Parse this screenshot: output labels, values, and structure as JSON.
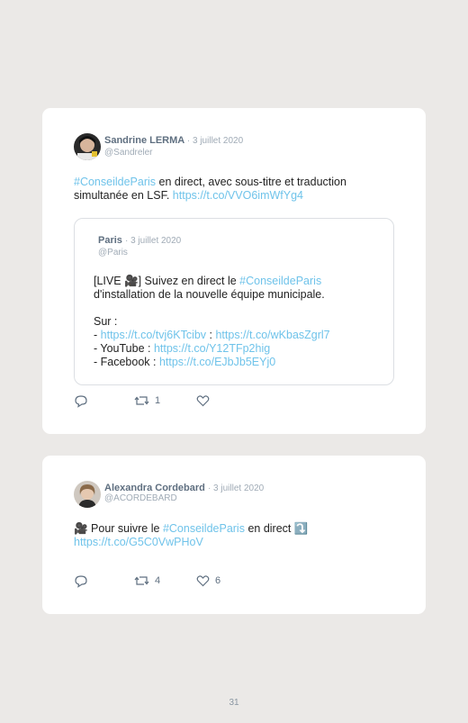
{
  "tweet1": {
    "author": "Sandrine LERMA",
    "date": "· 3 juillet 2020",
    "handle": "@Sandreler",
    "line1_tag": "#ConseildeParis",
    "line1_rest": " en direct, avec sous-titre et traduction",
    "line2_text": "simultanée en LSF. ",
    "line2_link": "https://t.co/VVO6imWfYg4",
    "quoted": {
      "author": "Paris",
      "date": "· 3 juillet 2020",
      "handle": "@Paris",
      "line1_pre": "[LIVE 🎥] Suivez en direct le ",
      "line1_tag": "#ConseildeParis",
      "line2": "d'installation de la nouvelle équipe municipale.",
      "line3": "Sur :",
      "line4_pre": "- ",
      "line4_link1": "https://t.co/tvj6KTcibv",
      "line4_sep": " : ",
      "line4_link2": "https://t.co/wKbasZgrl7",
      "line5_pre": "- YouTube : ",
      "line5_link": "https://t.co/Y12TFp2hig",
      "line6_pre": "- Facebook : ",
      "line6_link": "https://t.co/EJbJb5EYj0"
    },
    "retweets": "1",
    "likes": ""
  },
  "tweet2": {
    "author": "Alexandra Cordebard",
    "date": "· 3 juillet 2020",
    "handle": "@ACORDEBARD",
    "line1_pre": "🎥 Pour suivre le ",
    "line1_tag": "#ConseildeParis",
    "line1_post": " en direct ⤵️",
    "line2_link": "https://t.co/G5C0VwPHoV",
    "retweets": "4",
    "likes": "6"
  },
  "page_number": "31",
  "colors": {
    "link": "#6fc3ea",
    "background": "#ebe9e7",
    "card": "#ffffff"
  },
  "icons": [
    "reply-icon",
    "retweet-icon",
    "like-icon"
  ]
}
